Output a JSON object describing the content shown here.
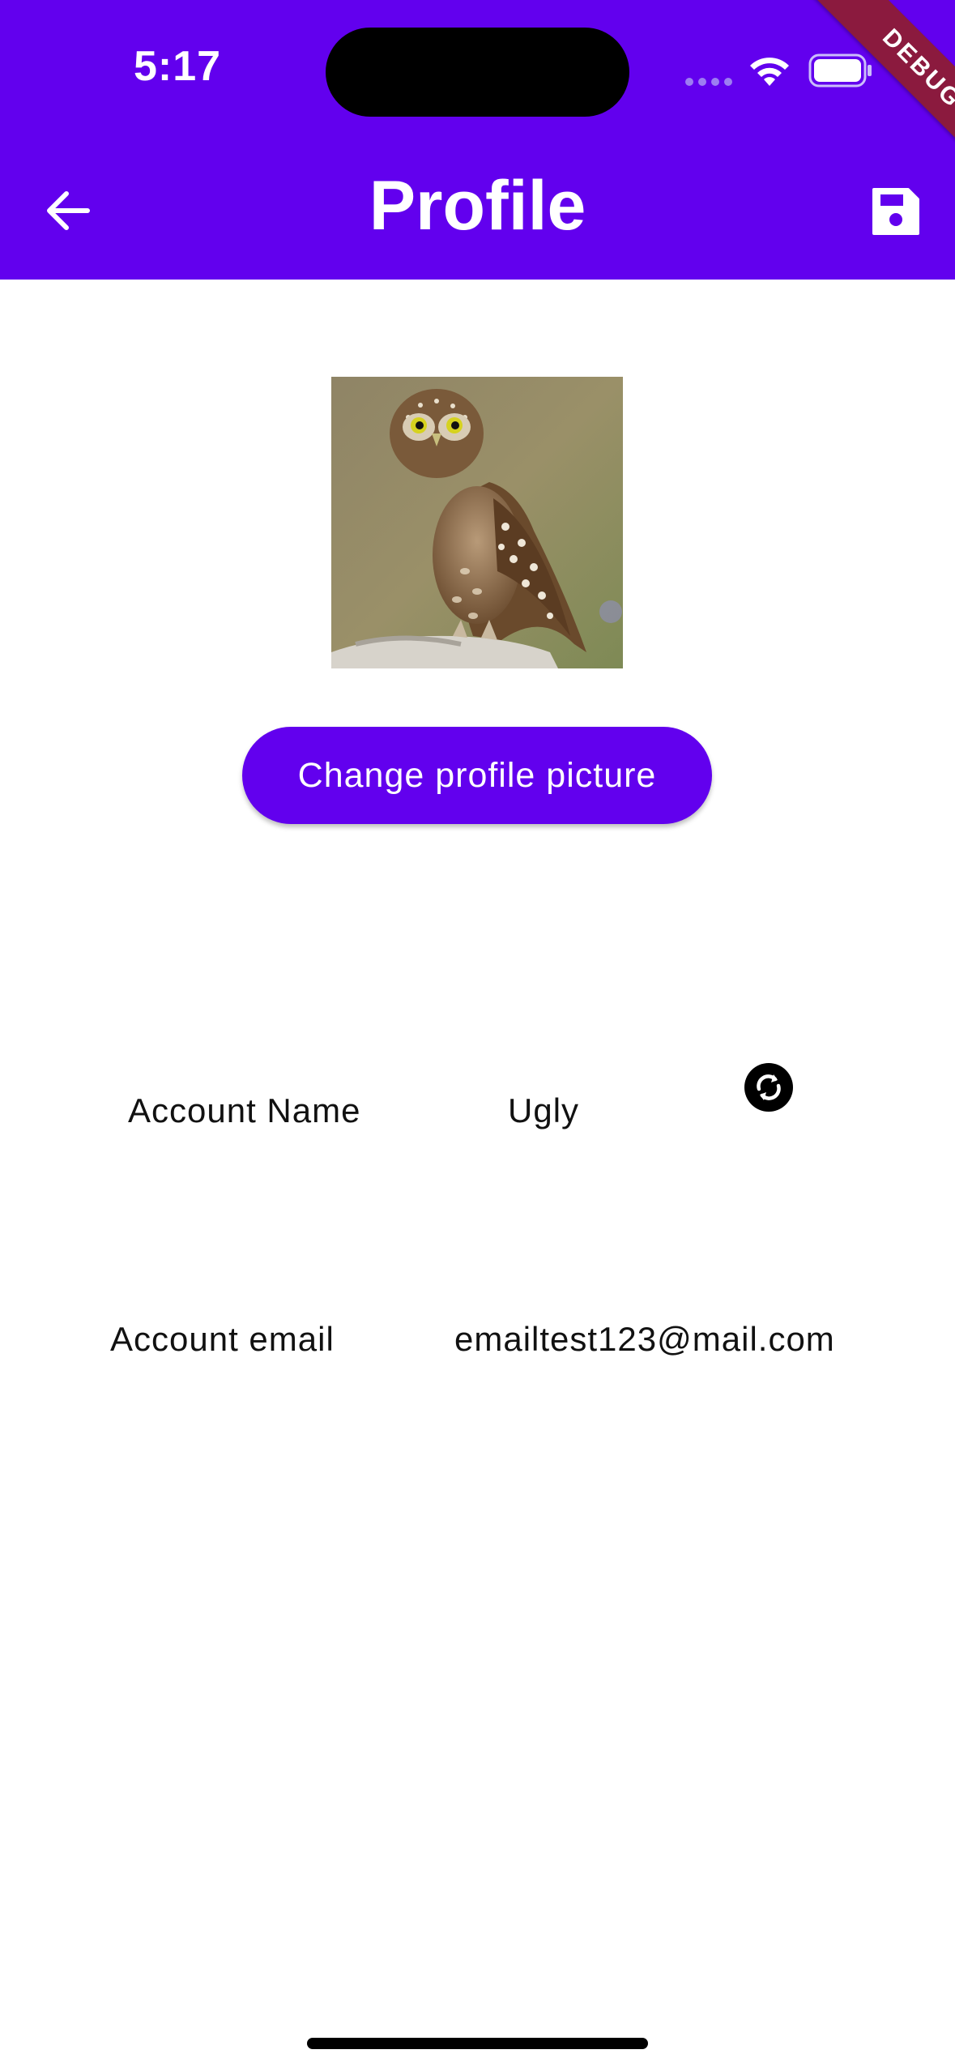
{
  "status_bar": {
    "time": "5:17"
  },
  "debug_banner": "DEBUG",
  "app_bar": {
    "title": "Profile",
    "back_icon": "arrow-back-icon",
    "save_icon": "save-icon"
  },
  "profile": {
    "image_description": "owl-photo",
    "change_picture_label": "Change profile picture"
  },
  "fields": {
    "name": {
      "label": "Account Name",
      "value": "Ugly",
      "action_icon": "refresh-icon"
    },
    "email": {
      "label": "Account email",
      "value": "emailtest123@mail.com"
    }
  },
  "colors": {
    "primary": "#6200EE",
    "debug": "#8b1a3e"
  }
}
